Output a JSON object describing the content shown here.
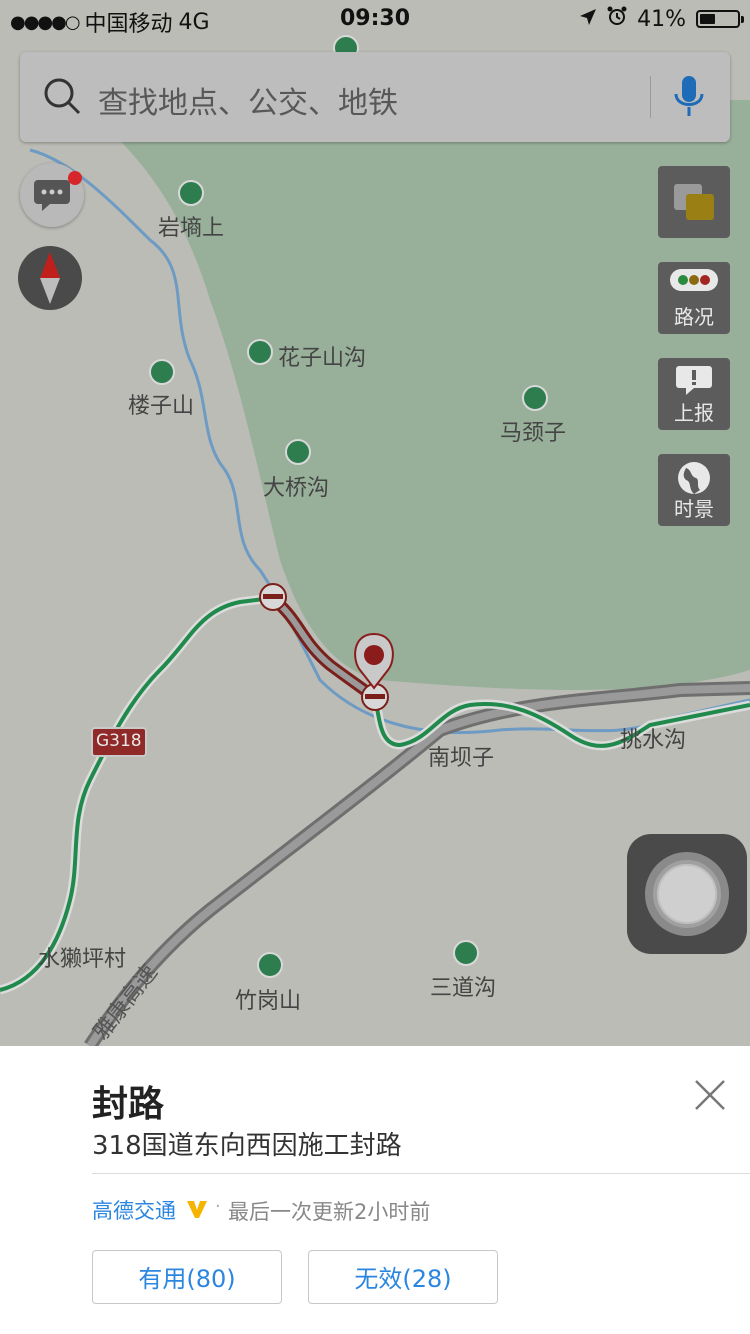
{
  "status_bar": {
    "carrier": "中国移动",
    "network": "4G",
    "time": "09:30",
    "battery_percent": "41%",
    "battery_level": 0.41
  },
  "search": {
    "placeholder": "查找地点、公交、地铁"
  },
  "side_buttons": {
    "traffic": "路况",
    "report": "上报",
    "live_view": "时景"
  },
  "map": {
    "labels": {
      "yanqiang": "岩墒上",
      "huazishangou": "花子山沟",
      "louzishan": "楼子山",
      "majingzi": "马颈子",
      "daqiaogou": "大桥沟",
      "nanbazi": "南坝子",
      "tiaoshuigou": "挑水沟",
      "shuitapingcun": "水獭坪村",
      "zhugangshan": "竹岗山",
      "sandaogou": "三道沟",
      "highway": "雅康高速",
      "road_shield": "G318"
    }
  },
  "incident": {
    "title": "封路",
    "description": "318国道东向西因施工封路",
    "source": "高德交通",
    "updated": "最后一次更新2小时前",
    "useful_label": "有用(80)",
    "invalid_label": "无效(28)"
  },
  "colors": {
    "accent": "#2b86e0",
    "closure_red": "#e8321e",
    "road_green": "#1f8a4c"
  }
}
